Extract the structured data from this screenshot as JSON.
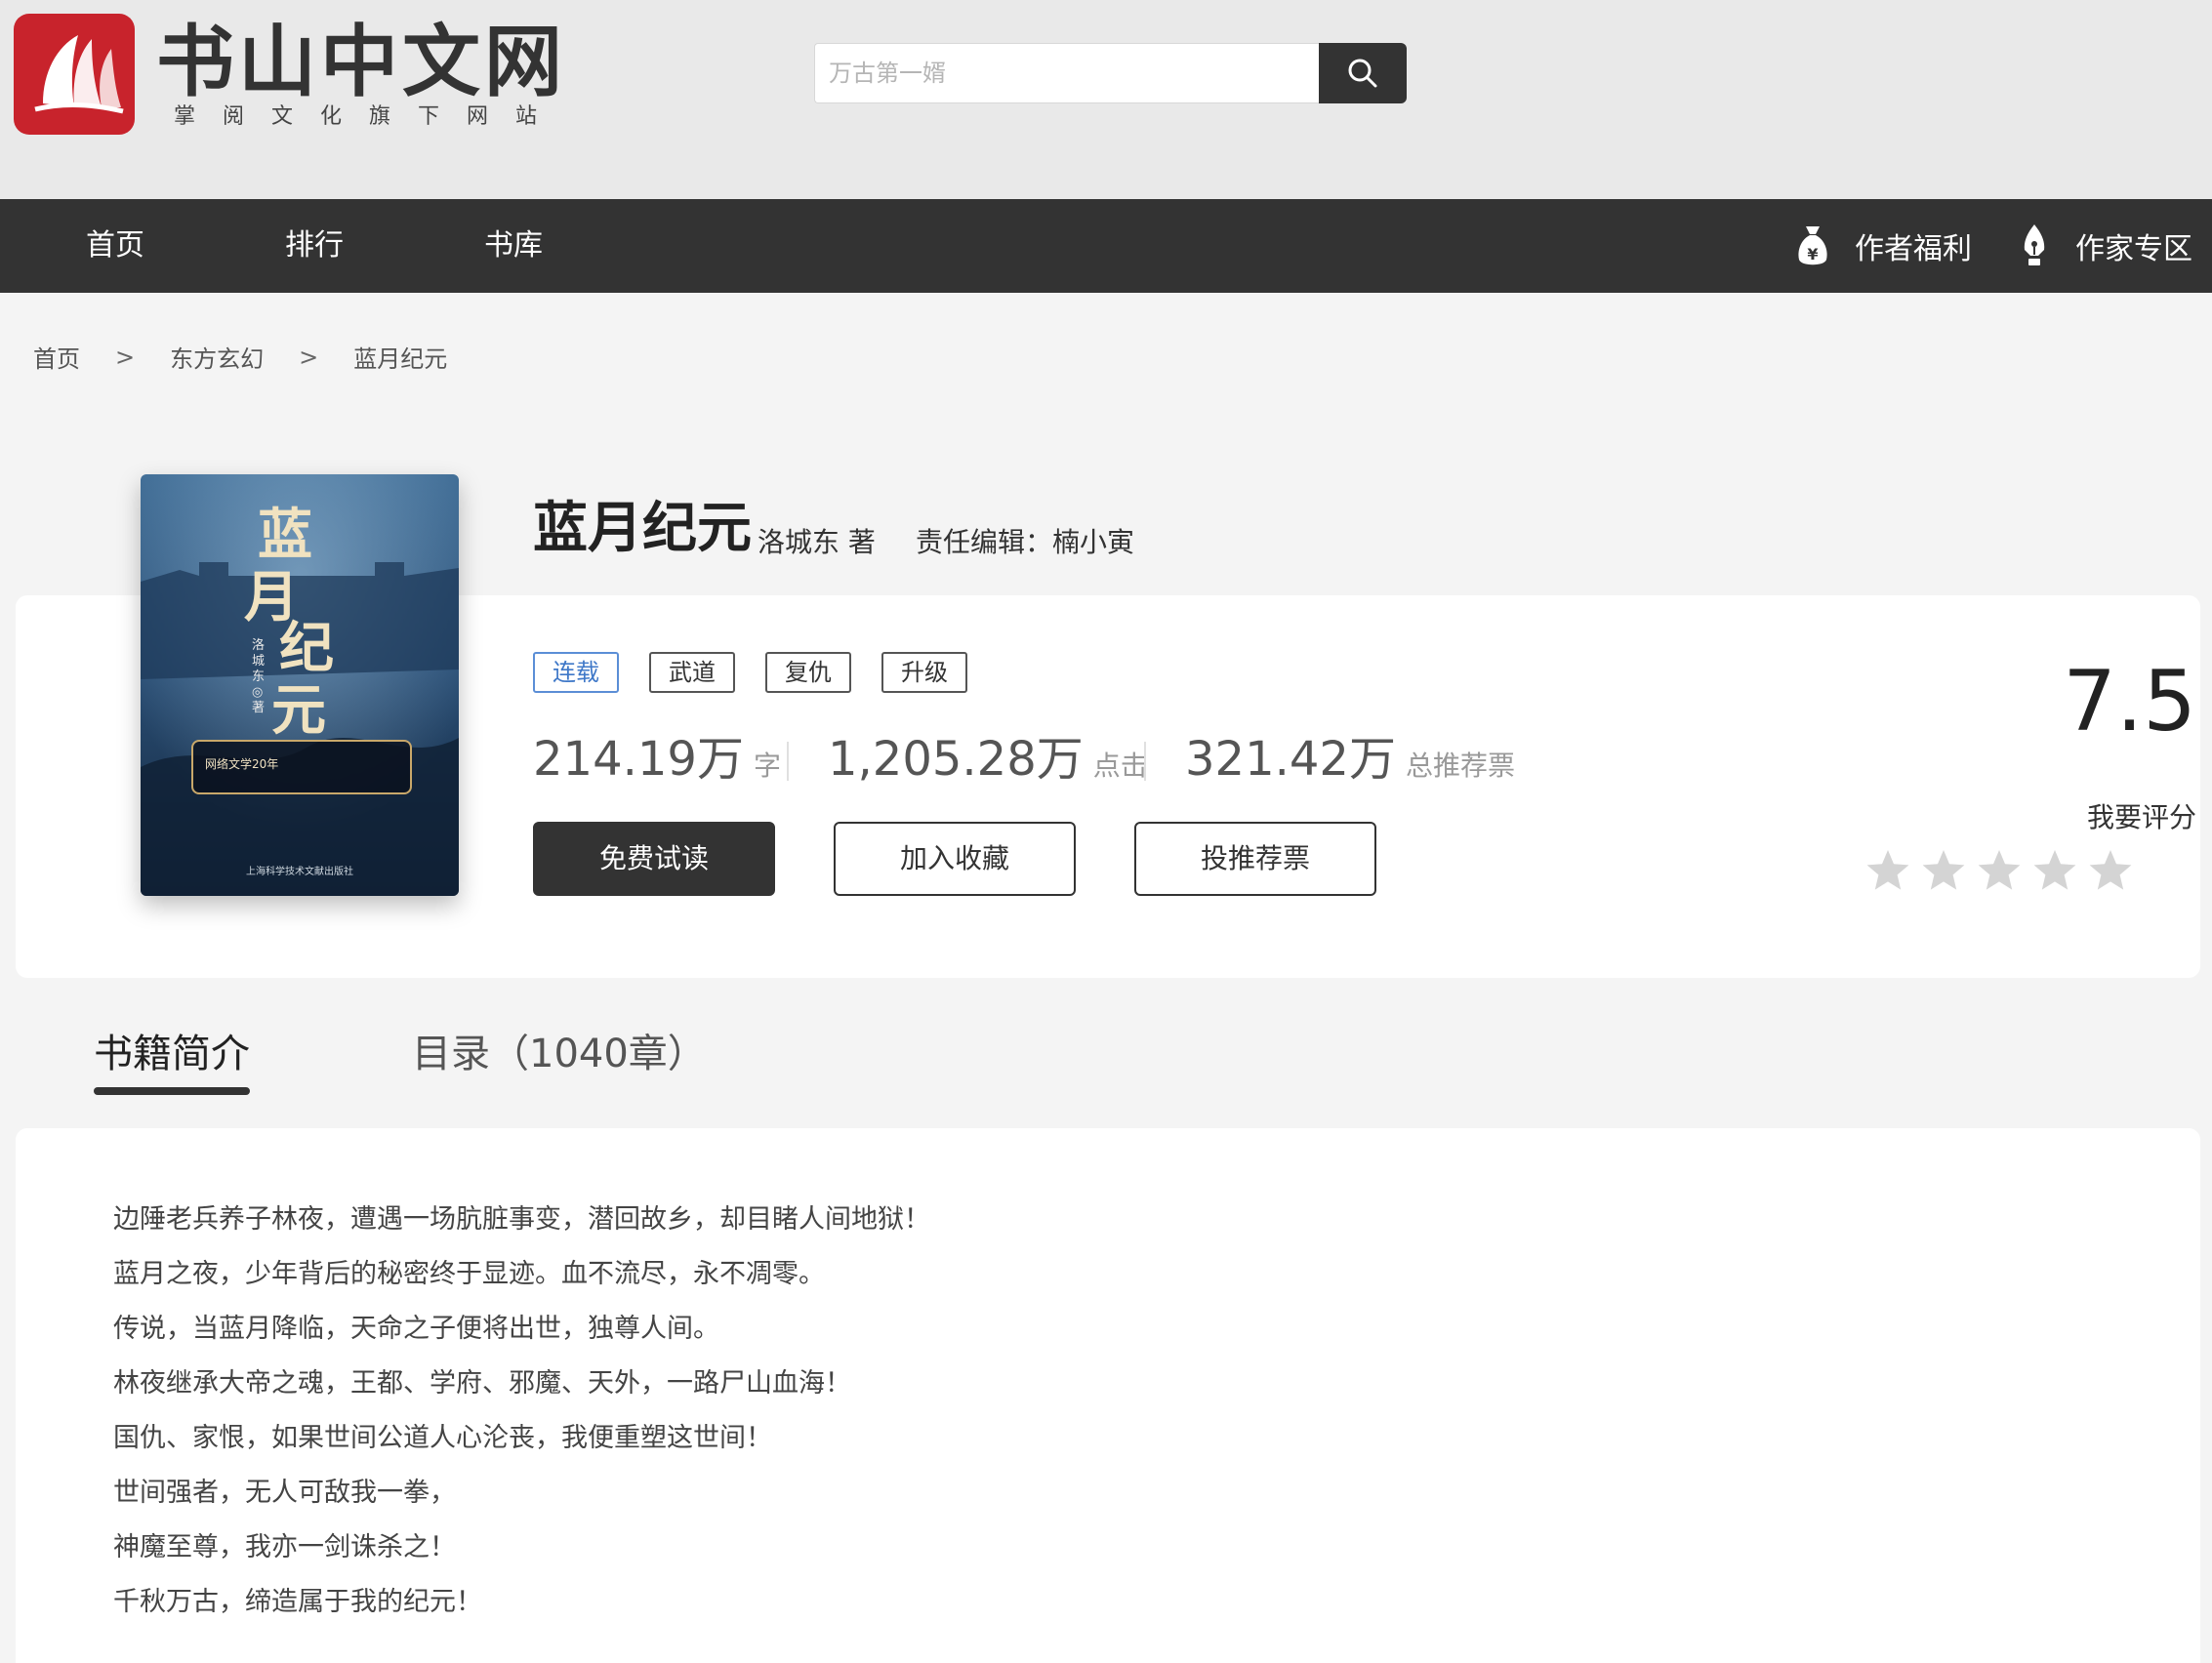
{
  "header": {
    "logo_title": "书山中文网",
    "logo_subtitle": "掌阅文化旗下网站",
    "search_placeholder": "万古第一婿"
  },
  "nav": {
    "items": [
      "首页",
      "排行",
      "书库"
    ],
    "author_welfare": "作者福利",
    "writer_zone": "作家专区"
  },
  "breadcrumb": {
    "home": "首页",
    "category": "东方玄幻",
    "current": "蓝月纪元",
    "separator": ">"
  },
  "book": {
    "title": "蓝月纪元",
    "author": "洛城东 著",
    "editor": "责任编辑：楠小寅",
    "tags": [
      "连载",
      "武道",
      "复仇",
      "升级"
    ],
    "stats": [
      {
        "value": "214.19万",
        "unit": "字"
      },
      {
        "value": "1,205.28万",
        "unit": "点击"
      },
      {
        "value": "321.42万",
        "unit": "总推荐票"
      }
    ],
    "buttons": {
      "read": "免费试读",
      "collect": "加入收藏",
      "recommend": "投推荐票"
    },
    "score": "7.5",
    "rate_label": "我要评分",
    "rating_stars_filled": 0,
    "rating_stars_total": 5
  },
  "cover": {
    "title_chars": [
      "蓝",
      "月",
      "纪",
      "元"
    ],
    "author": "洛城东◎著",
    "banner": "网络文学20年",
    "publisher": "上海科学技术文献出版社"
  },
  "tabs": {
    "intro": "书籍简介",
    "catalog": "目录（1040章）"
  },
  "intro": {
    "lines": [
      "边陲老兵养子林夜，遭遇一场肮脏事变，潜回故乡，却目睹人间地狱！",
      "蓝月之夜，少年背后的秘密终于显迹。血不流尽，永不凋零。",
      "传说，当蓝月降临，天命之子便将出世，独尊人间。",
      "林夜继承大帝之魂，王都、学府、邪魔、天外，一路尸山血海！",
      "国仇、家恨，如果世间公道人心沦丧，我便重塑这世间！",
      "世间强者，无人可敌我一拳，",
      "神魔至尊，我亦一剑诛杀之！",
      "千秋万古，缔造属于我的纪元！"
    ]
  },
  "colors": {
    "header_bg": "#e9e9e9",
    "nav_bg": "#333333",
    "logo_red": "#c8232c",
    "status_tag_blue": "#3f78c8",
    "star_grey": "#d4d4d4"
  }
}
